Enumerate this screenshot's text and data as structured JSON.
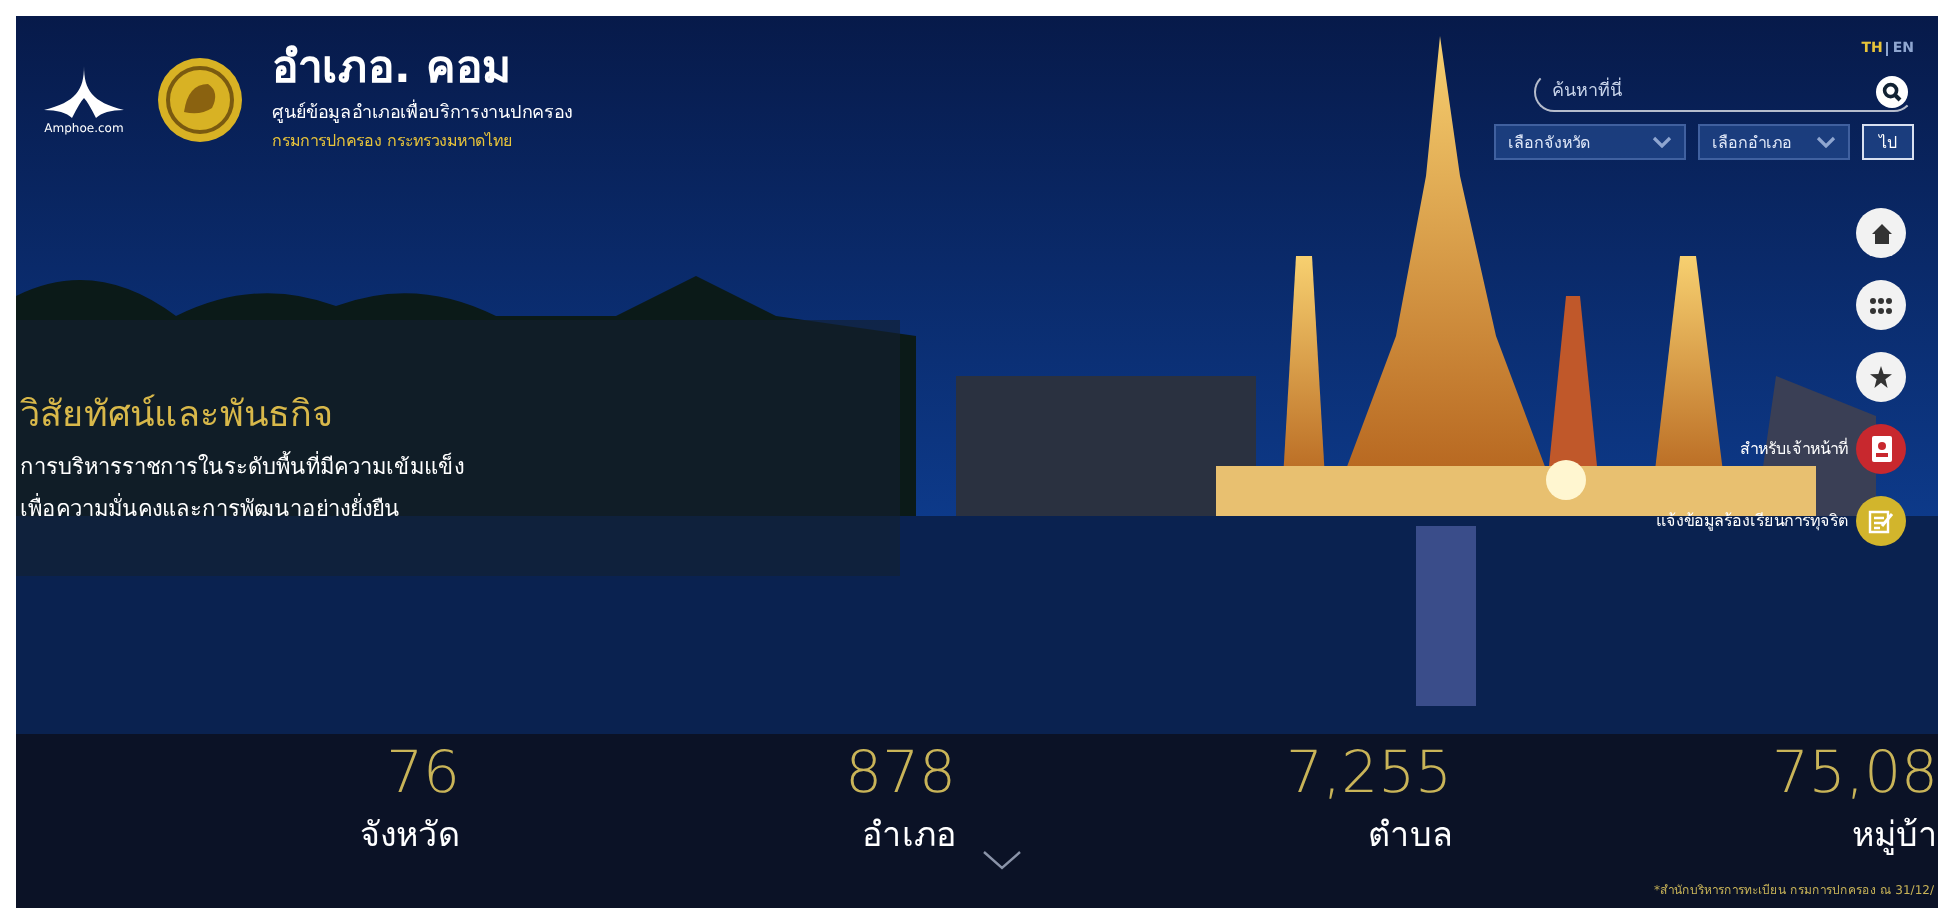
{
  "header": {
    "logo_caption": "Amphoe.com",
    "title": "อำเภอ. คอม",
    "subtitle": "ศูนย์ข้อมูลอำเภอเพื่อบริการงานปกครอง",
    "agency": "กรมการปกครอง กระทรวงมหาดไทย"
  },
  "languages": [
    {
      "label": "TH",
      "selected": true
    },
    {
      "label": "EN",
      "selected": false
    }
  ],
  "search": {
    "placeholder": "ค้นหาที่นี่"
  },
  "filters": [
    {
      "label": "เลือกจังหวัด"
    },
    {
      "label": "เลือกอำเภอ"
    }
  ],
  "go_button": "ไป",
  "side_menu": [
    {
      "kind": "home",
      "color": "#f2f2f2"
    },
    {
      "kind": "apps",
      "color": "#f2f2f2"
    },
    {
      "kind": "star",
      "color": "#f2f2f2"
    },
    {
      "kind": "staff",
      "color": "#c8282e",
      "label": "สำหรับเจ้าหน้าที่"
    },
    {
      "kind": "complaint",
      "color": "#d2b52c",
      "label": "แจ้งข้อมูลร้องเรียนการทุจริต"
    }
  ],
  "vision": {
    "title": "วิสัยทัศน์และพันธกิจ",
    "lines": [
      "การบริหารราชการในระดับพื้นที่มีความเข้มแข็ง",
      "เพื่อความมั่นคงและการพัฒนาอย่างยั่งยืน"
    ]
  },
  "stats": [
    {
      "value": "76",
      "label": "จังหวัด"
    },
    {
      "value": "878",
      "label": "อำเภอ"
    },
    {
      "value": "7,255",
      "label": "ตำบล"
    },
    {
      "value": "75,08",
      "label": "หมู่บ้า"
    }
  ],
  "footnote": "*สำนักบริหารการทะเบียน กรมการปกครอง ณ 31/12/"
}
